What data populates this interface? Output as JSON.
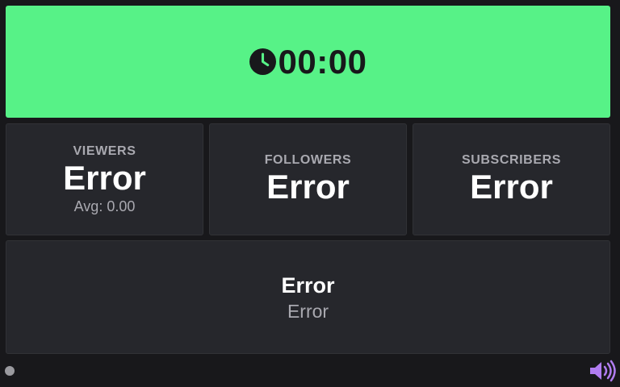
{
  "timer": {
    "icon": "clock-icon",
    "value": "00:00",
    "background": "#57f287"
  },
  "stats": [
    {
      "label": "VIEWERS",
      "value": "Error",
      "sub": "Avg: 0.00"
    },
    {
      "label": "FOLLOWERS",
      "value": "Error"
    },
    {
      "label": "SUBSCRIBERS",
      "value": "Error"
    }
  ],
  "info": {
    "title": "Error",
    "subtitle": "Error"
  },
  "status_bar": {
    "indicator_icon": "status-dot",
    "sound_icon": "volume-icon",
    "sound_color": "#b07cf0"
  }
}
